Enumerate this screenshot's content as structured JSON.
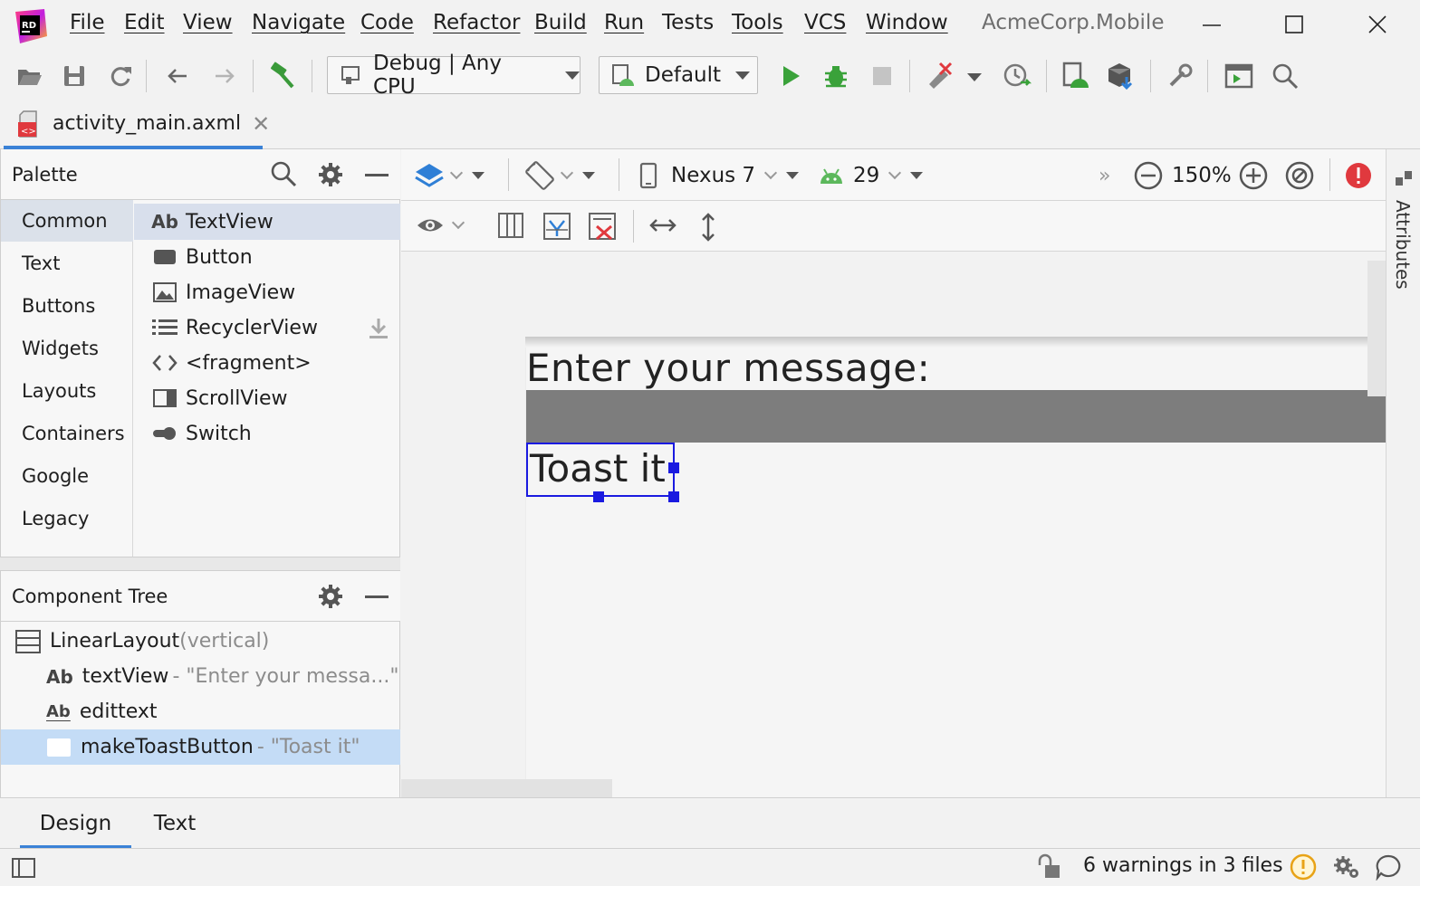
{
  "menu": {
    "items": [
      "File",
      "Edit",
      "View",
      "Navigate",
      "Code",
      "Refactor",
      "Build",
      "Run",
      "Tests",
      "Tools",
      "VCS",
      "Window"
    ],
    "app_title": "AcmeCorp.Mobile"
  },
  "toolbar": {
    "configuration": "Debug | Any CPU",
    "device_profile": "Default"
  },
  "editor_tab": {
    "filename": "activity_main.axml"
  },
  "palette": {
    "title": "Palette",
    "categories": [
      "Common",
      "Text",
      "Buttons",
      "Widgets",
      "Layouts",
      "Containers",
      "Google",
      "Legacy"
    ],
    "selected_category": "Common",
    "widgets": [
      "TextView",
      "Button",
      "ImageView",
      "RecyclerView",
      "<fragment>",
      "ScrollView",
      "Switch"
    ],
    "textview_prefix": "Ab"
  },
  "component_tree": {
    "title": "Component Tree",
    "root": {
      "name": "LinearLayout",
      "detail": "(vertical)"
    },
    "children": [
      {
        "icon_text": "Ab",
        "name": "textView",
        "detail": "- \"Enter your messa...\""
      },
      {
        "icon_text": "Ab",
        "name": "edittext",
        "detail": ""
      },
      {
        "icon_text": "",
        "name": "makeToastButton",
        "detail": "- \"Toast it\""
      }
    ]
  },
  "designer": {
    "device": "Nexus 7",
    "api_level": "29",
    "zoom": "150%",
    "preview": {
      "text_view": "Enter your message:",
      "button_text": "Toast it"
    }
  },
  "side_panel": {
    "label": "Attributes"
  },
  "bottom_tabs": [
    "Design",
    "Text"
  ],
  "status": {
    "warnings": "6 warnings in 3 files"
  },
  "colors": {
    "accent": "#3b82d6",
    "run_green": "#3aa23a",
    "error_red": "#e0393e",
    "warning_yellow": "#e8a317",
    "selection_blue": "#1a1ae0"
  }
}
